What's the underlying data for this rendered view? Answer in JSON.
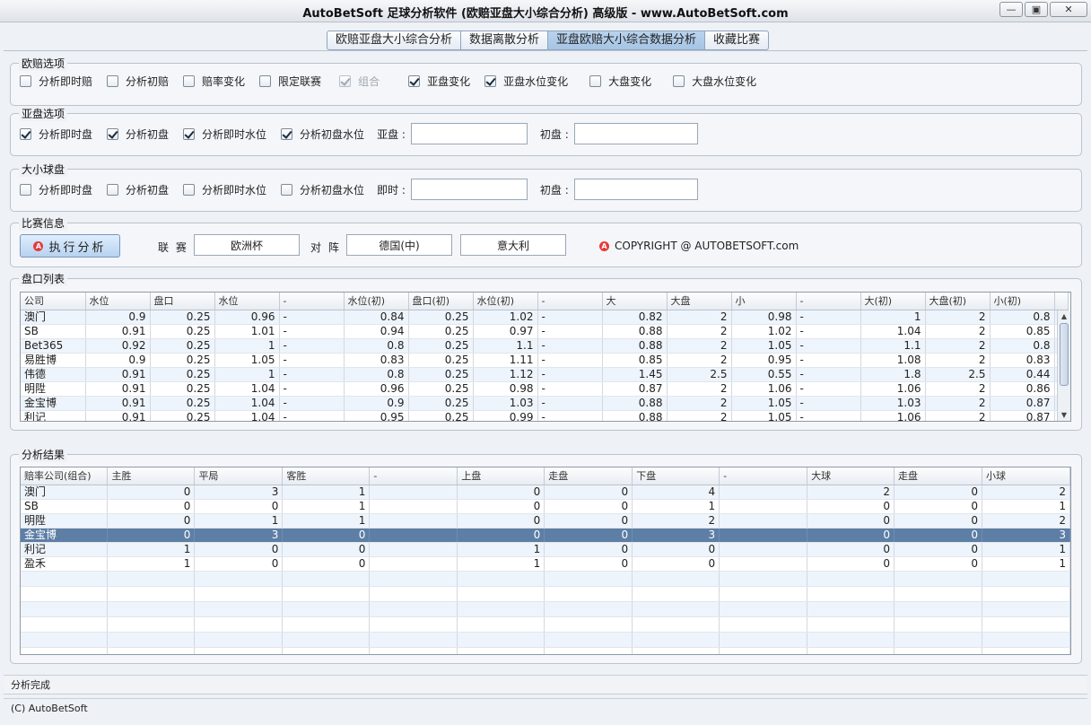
{
  "window": {
    "title": "AutoBetSoft 足球分析软件 (欧赔亚盘大小综合分析) 高级版   - www.AutoBetSoft.com",
    "minimize": "—",
    "restore": "▣",
    "close": "✕"
  },
  "tabs": [
    {
      "label": "欧赔亚盘大小综合分析"
    },
    {
      "label": "数据离散分析"
    },
    {
      "label": "亚盘欧赔大小综合数据分析",
      "active": true
    },
    {
      "label": "收藏比赛"
    }
  ],
  "euro_options": {
    "title": "欧赔选项",
    "items": [
      {
        "label": "分析即时赔",
        "checked": false
      },
      {
        "label": "分析初赔",
        "checked": false
      },
      {
        "label": "赔率变化",
        "checked": false
      },
      {
        "label": "限定联赛",
        "checked": false
      },
      {
        "label": "组合",
        "checked": true,
        "disabled": true
      },
      {
        "label": "亚盘变化",
        "checked": true
      },
      {
        "label": "亚盘水位变化",
        "checked": true
      },
      {
        "label": "大盘变化",
        "checked": false
      },
      {
        "label": "大盘水位变化",
        "checked": false
      }
    ]
  },
  "asian_options": {
    "title": "亚盘选项",
    "items": [
      {
        "label": "分析即时盘",
        "checked": true
      },
      {
        "label": "分析初盘",
        "checked": true
      },
      {
        "label": "分析即时水位",
        "checked": true
      },
      {
        "label": "分析初盘水位",
        "checked": true
      }
    ],
    "field1_label": "亚盘 :",
    "field1_value": "",
    "field2_label": "初盘 :",
    "field2_value": ""
  },
  "ou_options": {
    "title": "大小球盘",
    "items": [
      {
        "label": "分析即时盘",
        "checked": false
      },
      {
        "label": "分析初盘",
        "checked": false
      },
      {
        "label": "分析即时水位",
        "checked": false
      },
      {
        "label": "分析初盘水位",
        "checked": false
      }
    ],
    "field1_label": "即时 :",
    "field1_value": "",
    "field2_label": "初盘 :",
    "field2_value": ""
  },
  "match_info": {
    "title": "比赛信息",
    "run_button": "执行分析",
    "league_label": "联 赛",
    "league_value": "欧洲杯",
    "vs_label": "对 阵",
    "home": "德国(中)",
    "away": "意大利",
    "copyright": "COPYRIGHT @ AUTOBETSOFT.com"
  },
  "odds_list": {
    "title": "盘口列表",
    "headers": [
      "公司",
      "水位",
      "盘口",
      "水位",
      "-",
      "水位(初)",
      "盘口(初)",
      "水位(初)",
      "-",
      "大",
      "大盘",
      "小",
      "-",
      "大(初)",
      "大盘(初)",
      "小(初)"
    ],
    "rows": [
      [
        "澳门",
        "0.9",
        "0.25",
        "0.96",
        "-",
        "0.84",
        "0.25",
        "1.02",
        "-",
        "0.82",
        "2",
        "0.98",
        "-",
        "1",
        "2",
        "0.8"
      ],
      [
        "SB",
        "0.91",
        "0.25",
        "1.01",
        "-",
        "0.94",
        "0.25",
        "0.97",
        "-",
        "0.88",
        "2",
        "1.02",
        "-",
        "1.04",
        "2",
        "0.85"
      ],
      [
        "Bet365",
        "0.92",
        "0.25",
        "1",
        "-",
        "0.8",
        "0.25",
        "1.1",
        "-",
        "0.88",
        "2",
        "1.05",
        "-",
        "1.1",
        "2",
        "0.8"
      ],
      [
        "易胜博",
        "0.9",
        "0.25",
        "1.05",
        "-",
        "0.83",
        "0.25",
        "1.11",
        "-",
        "0.85",
        "2",
        "0.95",
        "-",
        "1.08",
        "2",
        "0.83"
      ],
      [
        "伟德",
        "0.91",
        "0.25",
        "1",
        "-",
        "0.8",
        "0.25",
        "1.12",
        "-",
        "1.45",
        "2.5",
        "0.55",
        "-",
        "1.8",
        "2.5",
        "0.44"
      ],
      [
        "明陞",
        "0.91",
        "0.25",
        "1.04",
        "-",
        "0.96",
        "0.25",
        "0.98",
        "-",
        "0.87",
        "2",
        "1.06",
        "-",
        "1.06",
        "2",
        "0.86"
      ],
      [
        "金宝博",
        "0.91",
        "0.25",
        "1.04",
        "-",
        "0.9",
        "0.25",
        "1.03",
        "-",
        "0.88",
        "2",
        "1.05",
        "-",
        "1.03",
        "2",
        "0.87"
      ],
      [
        "利记",
        "0.91",
        "0.25",
        "1.04",
        "-",
        "0.95",
        "0.25",
        "0.99",
        "-",
        "0.88",
        "2",
        "1.05",
        "-",
        "1.06",
        "2",
        "0.87"
      ]
    ]
  },
  "results": {
    "title": "分析结果",
    "headers": [
      "赔率公司(组合)",
      "主胜",
      "平局",
      "客胜",
      "-",
      "上盘",
      "走盘",
      "下盘",
      "-",
      "大球",
      "走盘",
      "小球"
    ],
    "rows": [
      [
        "澳门",
        "0",
        "3",
        "1",
        "",
        "0",
        "0",
        "4",
        "",
        "2",
        "0",
        "2"
      ],
      [
        "SB",
        "0",
        "0",
        "1",
        "",
        "0",
        "0",
        "1",
        "",
        "0",
        "0",
        "1"
      ],
      [
        "明陞",
        "0",
        "1",
        "1",
        "",
        "0",
        "0",
        "2",
        "",
        "0",
        "0",
        "2"
      ],
      [
        "金宝博",
        "0",
        "3",
        "0",
        "",
        "0",
        "0",
        "3",
        "",
        "0",
        "0",
        "3"
      ],
      [
        "利记",
        "1",
        "0",
        "0",
        "",
        "1",
        "0",
        "0",
        "",
        "0",
        "0",
        "1"
      ],
      [
        "盈禾",
        "1",
        "0",
        "0",
        "",
        "1",
        "0",
        "0",
        "",
        "0",
        "0",
        "1"
      ]
    ],
    "selected_row": 3
  },
  "status": {
    "message": "分析完成",
    "footer": "(C) AutoBetSoft"
  }
}
